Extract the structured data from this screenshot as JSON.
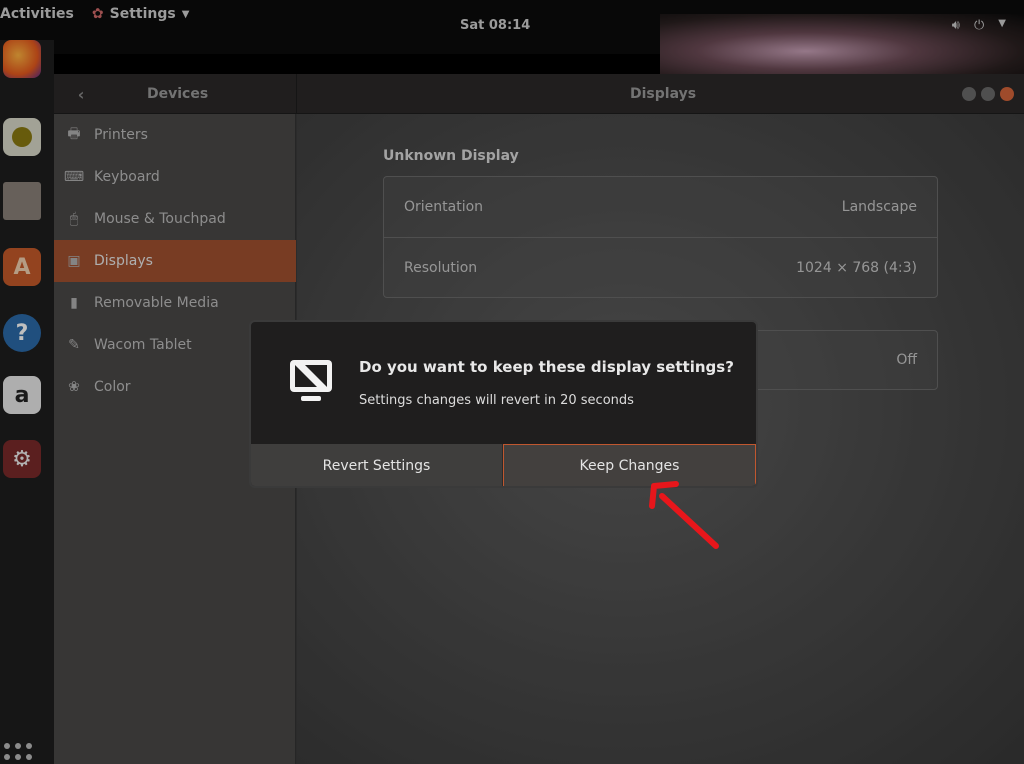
{
  "topbar": {
    "activities": "Activities",
    "app_menu": "Settings",
    "clock": "Sat 08:14"
  },
  "dock": {
    "icons": [
      "firefox-icon",
      "rhythmbox-icon",
      "files-icon",
      "software-icon",
      "help-icon",
      "amazon-icon",
      "settings-icon"
    ]
  },
  "window": {
    "left_title": "Devices",
    "right_title": "Displays"
  },
  "sidebar": {
    "items": [
      {
        "label": "Printers",
        "icon": "printer-icon"
      },
      {
        "label": "Keyboard",
        "icon": "keyboard-icon"
      },
      {
        "label": "Mouse & Touchpad",
        "icon": "mouse-icon"
      },
      {
        "label": "Displays",
        "icon": "display-icon"
      },
      {
        "label": "Removable Media",
        "icon": "usb-icon"
      },
      {
        "label": "Wacom Tablet",
        "icon": "tablet-icon"
      },
      {
        "label": "Color",
        "icon": "color-icon"
      }
    ],
    "active": "Displays"
  },
  "content": {
    "section_title": "Unknown Display",
    "orientation_label": "Orientation",
    "orientation_value": "Landscape",
    "resolution_label": "Resolution",
    "resolution_value": "1024 × 768 (4:3)",
    "night_light_value": "Off"
  },
  "dialog": {
    "heading": "Do you want to keep these display settings?",
    "subtext": "Settings changes will revert in 20 seconds",
    "revert_label": "Revert Settings",
    "keep_label": "Keep Changes"
  },
  "colors": {
    "accent": "#c0572f",
    "annotation_arrow": "#e8161b"
  }
}
